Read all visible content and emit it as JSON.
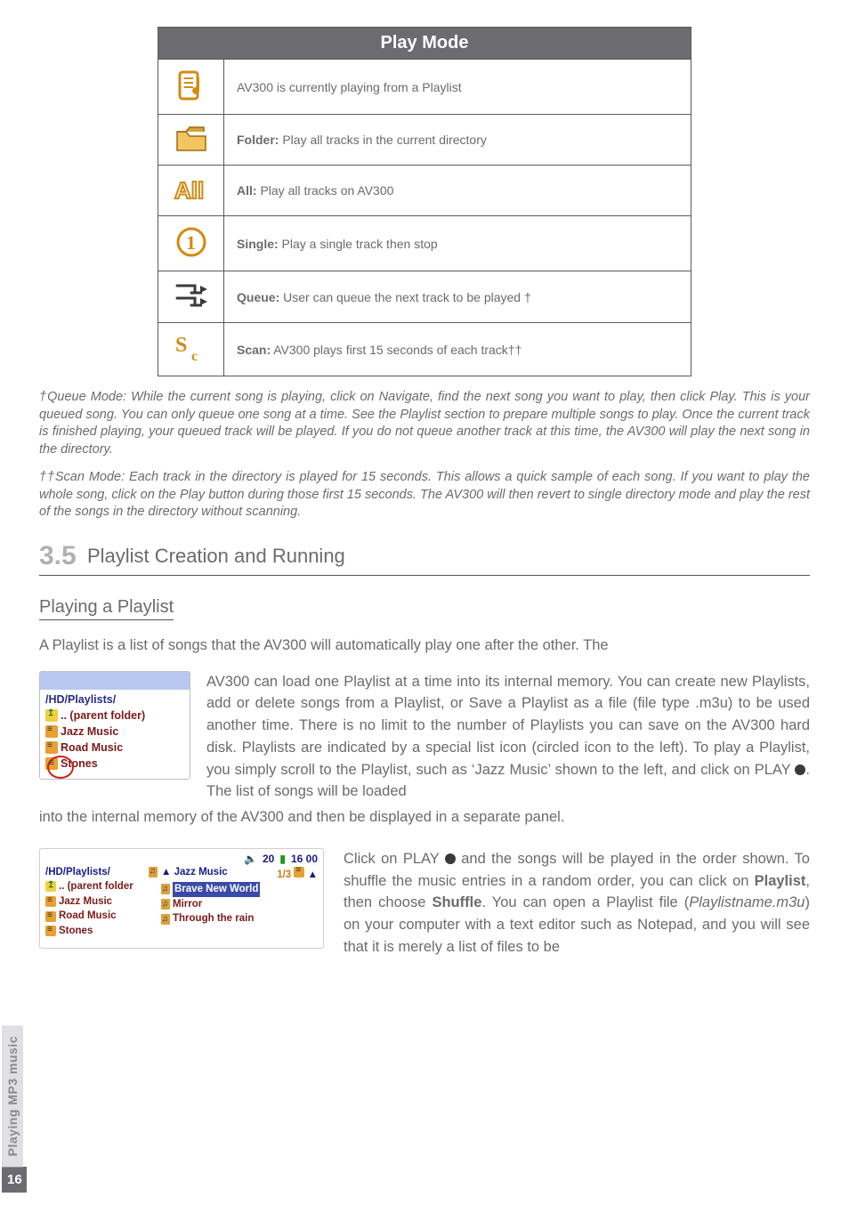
{
  "table": {
    "title": "Play Mode",
    "rows": [
      {
        "icon": "playlist-icon",
        "text": "AV300 is currently playing from a Playlist"
      },
      {
        "icon": "folder-icon",
        "bold": "Folder:",
        "text": " Play all tracks in the current directory"
      },
      {
        "icon": "all-icon",
        "bold": "All:",
        "text": " Play all tracks on AV300"
      },
      {
        "icon": "single-icon",
        "bold": "Single:",
        "text": " Play a single track then stop"
      },
      {
        "icon": "queue-icon",
        "bold": "Queue:",
        "text": " User can queue the next track to be played †"
      },
      {
        "icon": "scan-icon",
        "bold": "Scan:",
        "text": " AV300 plays first 15 seconds of each track††"
      }
    ]
  },
  "footnote1": "†Queue Mode: While the current song is playing, click on Navigate, find the next song you want to play, then click Play. This is your queued song. You can only queue one song at a time. See the Playlist section to prepare multiple songs to play. Once the current track is finished playing, your queued track will be played. If you do not queue another track at this time, the AV300 will play the next song in the directory.",
  "footnote2": "††Scan Mode: Each track in the directory is played for 15 seconds. This allows a quick sample of each song. If you want to play the whole song, click on the Play button during those first 15 seconds. The AV300 will then revert to single directory mode and play the rest of the songs in the directory without scanning.",
  "section_num": "3.5",
  "section_title": "Playlist Creation and Running",
  "sub_title": "Playing a Playlist",
  "para_lead": "A Playlist is a list of songs that the AV300 will automatically play one after the other. The",
  "para_block": "AV300 can load one Playlist at a time into its internal memory. You can create new Playlists, add or delete songs from a Playlist, or Save a Playlist as a file (file type .m3u) to be used another time. There is no limit to the number of Playlists you can save on the AV300 hard disk. Playlists are indicated by a special list icon (circled icon to the left). To play a Playlist, you simply scroll to the Playlist, such as ‘Jazz Music’ shown to the left, and click on PLAY ",
  "para_block_tail": ". The list of songs will be loaded",
  "para_continue": "into the internal memory of the AV300 and then be displayed in a separate panel.",
  "lower_a": "Click on PLAY ",
  "lower_b": " and the songs will be played in the order shown. To shuffle the music entries in a random order, you can click on ",
  "lower_c": ", then choose ",
  "lower_d": ". You can open a Playlist file (",
  "lower_e": ") on your computer with a text editor such as Notepad, and you will see that it is merely a list of files to be",
  "bold_playlist": "Playlist",
  "bold_shuffle": "Shuffle",
  "italic_fname": "Playlistname.m3u",
  "shot1": {
    "path": "/HD/Playlists/",
    "rows": [
      ".. (parent folder)",
      "Jazz Music",
      "Road Music",
      "Stones"
    ]
  },
  "chart_data": {
    "type": "table",
    "status_time1": "20",
    "status_time2": "16 00",
    "left_path": "/HD/Playlists/",
    "left_rows": [
      ".. (parent folder",
      "Jazz Music",
      "Road Music",
      "Stones"
    ],
    "right_title": "Jazz Music",
    "right_count": "1/3",
    "right_rows": [
      "Brave New World",
      "Mirror",
      "Through the rain"
    ]
  },
  "side_label": "Playing MP3 music",
  "page_number": "16"
}
